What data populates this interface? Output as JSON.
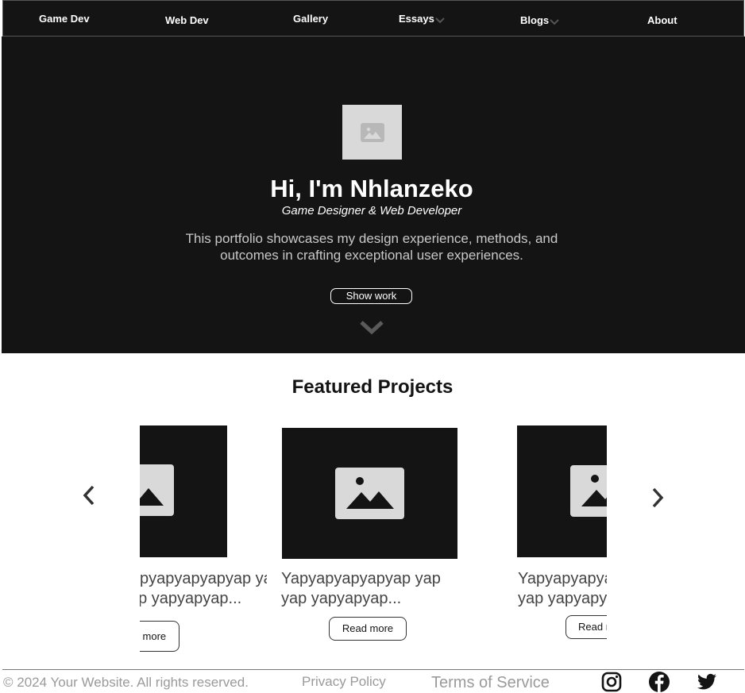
{
  "nav": {
    "items": [
      {
        "label": "Game Dev"
      },
      {
        "label": "Web Dev"
      },
      {
        "label": "Gallery"
      },
      {
        "label": "Essays"
      },
      {
        "label": "Blogs"
      },
      {
        "label": "About"
      }
    ]
  },
  "hero": {
    "title": "Hi, I'm Nhlanzeko",
    "subtitle": "Game Designer & Web Developer",
    "description": "This portfolio showcases my design experience, methods, and outcomes in crafting exceptional user experiences.",
    "button_label": "Show work"
  },
  "featured": {
    "title": "Featured Projects",
    "cards": [
      {
        "line1": "Yapyapyapyapyap yap",
        "line2": "yap yapyapyap...",
        "button_label": "Read more"
      },
      {
        "line1": "Yapyapyapyapyap yap",
        "line2": "yap yapyapyap...",
        "button_label": "Read more"
      },
      {
        "line1": "Yapyapyapyapyap yap",
        "line2": "yap yapyapyap...",
        "button_label": "Read more"
      }
    ]
  },
  "icons": {
    "dropdown": "chevron-down-icon",
    "image_placeholder": "image-icon",
    "prev": "chevron-left-icon",
    "next": "chevron-right-icon",
    "social": [
      "instagram-icon",
      "facebook-icon",
      "twitter-icon"
    ]
  },
  "colors": {
    "dark_background": "#141414",
    "placeholder": "#d9d9d9",
    "footer_text": "#9a9a9a"
  },
  "footer": {
    "copyright": "© 2024 Your Website. All rights reserved.",
    "privacy": "Privacy Policy",
    "terms": "Terms of Service"
  }
}
